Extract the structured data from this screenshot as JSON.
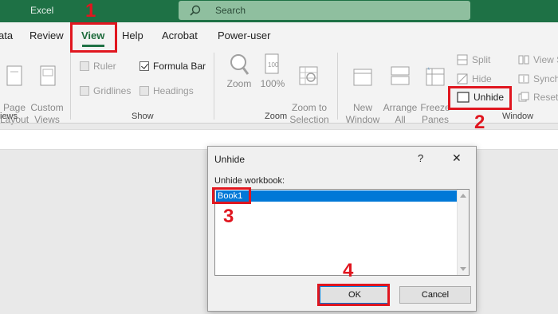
{
  "titlebar": {
    "app_name": "Excel",
    "search_placeholder": "Search"
  },
  "tabs": [
    {
      "label": "ata"
    },
    {
      "label": "Review"
    },
    {
      "label": "View",
      "active": true
    },
    {
      "label": "Help"
    },
    {
      "label": "Acrobat"
    },
    {
      "label": "Power-user"
    }
  ],
  "ribbon": {
    "workbook_views": {
      "page_layout": "Page\nLayout",
      "custom_views": "Custom\nViews",
      "group_label": "iews"
    },
    "show": {
      "ruler": "Ruler",
      "formula_bar": "Formula Bar",
      "gridlines": "Gridlines",
      "headings": "Headings",
      "group_label": "Show",
      "formula_bar_checked": true
    },
    "zoom": {
      "zoom": "Zoom",
      "hundred": "100%",
      "zoom_to_selection": "Zoom to\nSelection",
      "group_label": "Zoom"
    },
    "window": {
      "new_window": "New\nWindow",
      "arrange_all": "Arrange\nAll",
      "freeze_panes": "Freeze\nPanes",
      "split": "Split",
      "hide": "Hide",
      "unhide": "Unhide",
      "view_side": "View S",
      "synch": "Synch",
      "reset": "Reset",
      "group_label": "Window"
    }
  },
  "annotations": {
    "n1": "1",
    "n2": "2",
    "n3": "3",
    "n4": "4"
  },
  "dialog": {
    "title": "Unhide",
    "help": "?",
    "close": "✕",
    "list_label": "Unhide workbook:",
    "items": [
      "Book1"
    ],
    "ok": "OK",
    "cancel": "Cancel"
  },
  "colors": {
    "excel_green": "#1e7145",
    "annotation_red": "#e0161f",
    "selection_blue": "#0078d7"
  }
}
